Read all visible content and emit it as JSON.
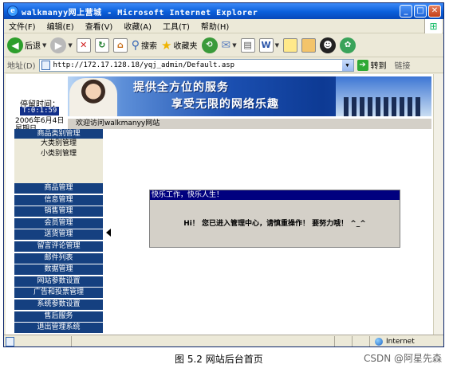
{
  "window": {
    "title": "walkmanyy网上营城 - Microsoft Internet Explorer",
    "controls": [
      "_",
      "□",
      "✕"
    ]
  },
  "menu": [
    "文件(F)",
    "编辑(E)",
    "查看(V)",
    "收藏(A)",
    "工具(T)",
    "帮助(H)"
  ],
  "toolbar": {
    "back_label": "后退",
    "search_label": "搜索",
    "favorites_label": "收藏夹"
  },
  "address": {
    "label": "地址(D)",
    "url": "http://172.17.128.18/yqj_admin/Default.asp",
    "go_label": "转到",
    "links_label": "链接"
  },
  "page": {
    "clock_label": "停留时间：",
    "clock_value": "T:0:1:59",
    "date_text": "2006年6月4日 星期日",
    "banner_line1": "提供全方位的服务",
    "banner_line2": "享受无限的网络乐趣",
    "welcome_text": "欢迎访问walkmanyy网站",
    "category": {
      "header": "商品类别管理",
      "items": [
        "大类别管理",
        "小类别管理"
      ]
    },
    "menu_items": [
      "商品管理",
      "信息管理",
      "销售管理",
      "会员管理",
      "送货管理",
      "留言评论管理",
      "邮件列表",
      "数据管理",
      "网站参数设置",
      "广告和投票管理",
      "系统参数设置",
      "售后服务",
      "退出管理系统"
    ],
    "message": {
      "title": "快乐工作，快乐人生！",
      "body": "Hi！ 您已进入管理中心，请慎重操作！ 要努力哦！ ^_^"
    }
  },
  "status": {
    "zone": "Internet"
  },
  "figure_caption": "图 5.2   网站后台首页",
  "watermark": "CSDN @阿星先森",
  "colors": {
    "menu_blue": "#154080",
    "dialog_title": "#00007f",
    "titlebar": "#0a5fdb"
  }
}
